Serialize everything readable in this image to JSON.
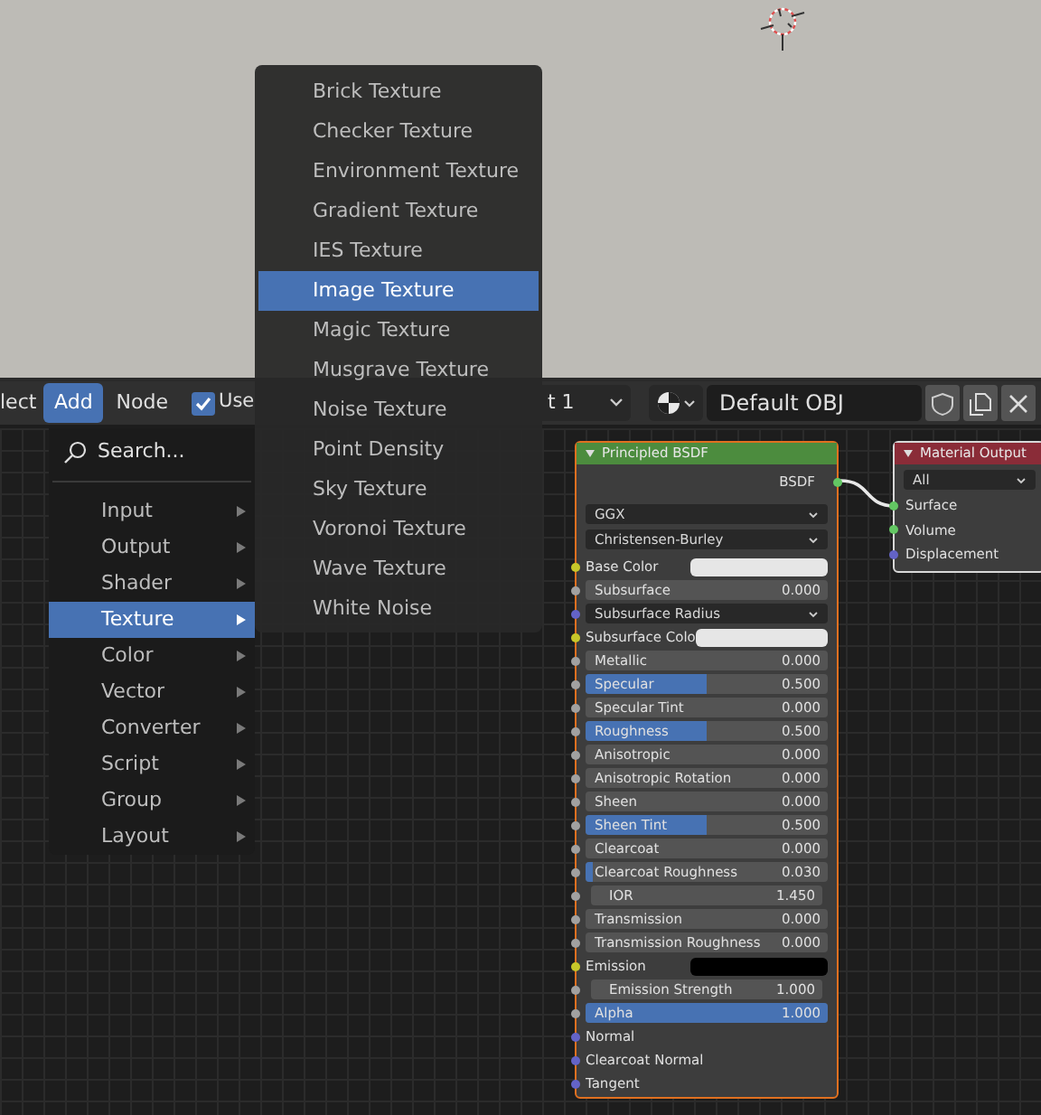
{
  "header": {
    "cut_label": "lect",
    "menus": [
      {
        "label": "Add",
        "selected": true
      },
      {
        "label": "Node",
        "selected": false
      }
    ],
    "use_nodes": {
      "label": "Use",
      "checked": true
    },
    "slot": "t 1",
    "material": "Default OBJ"
  },
  "add_menu": {
    "search": "Search...",
    "items": [
      {
        "label": "Input",
        "selected": false
      },
      {
        "label": "Output",
        "selected": false
      },
      {
        "label": "Shader",
        "selected": false
      },
      {
        "label": "Texture",
        "selected": true
      },
      {
        "label": "Color",
        "selected": false
      },
      {
        "label": "Vector",
        "selected": false
      },
      {
        "label": "Converter",
        "selected": false
      },
      {
        "label": "Script",
        "selected": false
      },
      {
        "label": "Group",
        "selected": false
      },
      {
        "label": "Layout",
        "selected": false
      }
    ]
  },
  "texture_menu": {
    "items": [
      {
        "label": "Brick Texture",
        "selected": false
      },
      {
        "label": "Checker Texture",
        "selected": false
      },
      {
        "label": "Environment Texture",
        "selected": false
      },
      {
        "label": "Gradient Texture",
        "selected": false
      },
      {
        "label": "IES Texture",
        "selected": false
      },
      {
        "label": "Image Texture",
        "selected": true
      },
      {
        "label": "Magic Texture",
        "selected": false
      },
      {
        "label": "Musgrave Texture",
        "selected": false
      },
      {
        "label": "Noise Texture",
        "selected": false
      },
      {
        "label": "Point Density",
        "selected": false
      },
      {
        "label": "Sky Texture",
        "selected": false
      },
      {
        "label": "Voronoi Texture",
        "selected": false
      },
      {
        "label": "Wave Texture",
        "selected": false
      },
      {
        "label": "White Noise",
        "selected": false
      }
    ]
  },
  "bsdf_node": {
    "title": "Principled BSDF",
    "output": "BSDF",
    "dropdowns": [
      "GGX",
      "Christensen-Burley"
    ],
    "inputs": [
      {
        "kind": "color",
        "label": "Base Color",
        "color": "#c7c729",
        "swatch": {
          "color": "#e6e6e6"
        }
      },
      {
        "kind": "slider",
        "label": "Subsurface",
        "value": "0.000",
        "level": 0,
        "color": "#a1a1a1"
      },
      {
        "kind": "dropdown",
        "label": "Subsurface Radius",
        "color": "#6363c7"
      },
      {
        "kind": "color",
        "label": "Subsurface Colo",
        "color": "#c7c729",
        "swatch": {
          "color": "#e6e6e6"
        }
      },
      {
        "kind": "slider",
        "label": "Metallic",
        "value": "0.000",
        "level": 0,
        "color": "#a1a1a1"
      },
      {
        "kind": "slider",
        "label": "Specular",
        "value": "0.500",
        "level": 0.5,
        "color": "#a1a1a1"
      },
      {
        "kind": "slider",
        "label": "Specular Tint",
        "value": "0.000",
        "level": 0,
        "color": "#a1a1a1"
      },
      {
        "kind": "slider",
        "label": "Roughness",
        "value": "0.500",
        "level": 0.5,
        "color": "#a1a1a1"
      },
      {
        "kind": "slider",
        "label": "Anisotropic",
        "value": "0.000",
        "level": 0,
        "color": "#a1a1a1"
      },
      {
        "kind": "slider",
        "label": "Anisotropic Rotation",
        "value": "0.000",
        "level": 0,
        "color": "#a1a1a1"
      },
      {
        "kind": "slider",
        "label": "Sheen",
        "value": "0.000",
        "level": 0,
        "color": "#a1a1a1"
      },
      {
        "kind": "slider",
        "label": "Sheen Tint",
        "value": "0.500",
        "level": 0.5,
        "color": "#a1a1a1"
      },
      {
        "kind": "slider",
        "label": "Clearcoat",
        "value": "0.000",
        "level": 0,
        "color": "#a1a1a1"
      },
      {
        "kind": "slider",
        "label": "Clearcoat Roughness",
        "value": "0.030",
        "level": 0.03,
        "color": "#a1a1a1"
      },
      {
        "kind": "number",
        "label": "IOR",
        "value": "1.450",
        "color": "#a1a1a1"
      },
      {
        "kind": "slider",
        "label": "Transmission",
        "value": "0.000",
        "level": 0,
        "color": "#a1a1a1"
      },
      {
        "kind": "slider",
        "label": "Transmission Roughness",
        "value": "0.000",
        "level": 0,
        "color": "#a1a1a1"
      },
      {
        "kind": "color",
        "label": "Emission",
        "color": "#c7c729",
        "swatch": {
          "color": "#000000"
        }
      },
      {
        "kind": "number",
        "label": "Emission Strength",
        "value": "1.000",
        "color": "#a1a1a1"
      },
      {
        "kind": "slider",
        "label": "Alpha",
        "value": "1.000",
        "level": 1,
        "color": "#a1a1a1"
      },
      {
        "kind": "socket",
        "label": "Normal",
        "color": "#6363c7"
      },
      {
        "kind": "socket",
        "label": "Clearcoat Normal",
        "color": "#6363c7"
      },
      {
        "kind": "socket",
        "label": "Tangent",
        "color": "#6363c7"
      }
    ]
  },
  "output_node": {
    "title": "Material Output",
    "dropdown": "All",
    "inputs": [
      {
        "label": "Surface",
        "color": "#63c763"
      },
      {
        "label": "Volume",
        "color": "#63c763"
      },
      {
        "label": "Displacement",
        "color": "#6363c7"
      }
    ]
  }
}
